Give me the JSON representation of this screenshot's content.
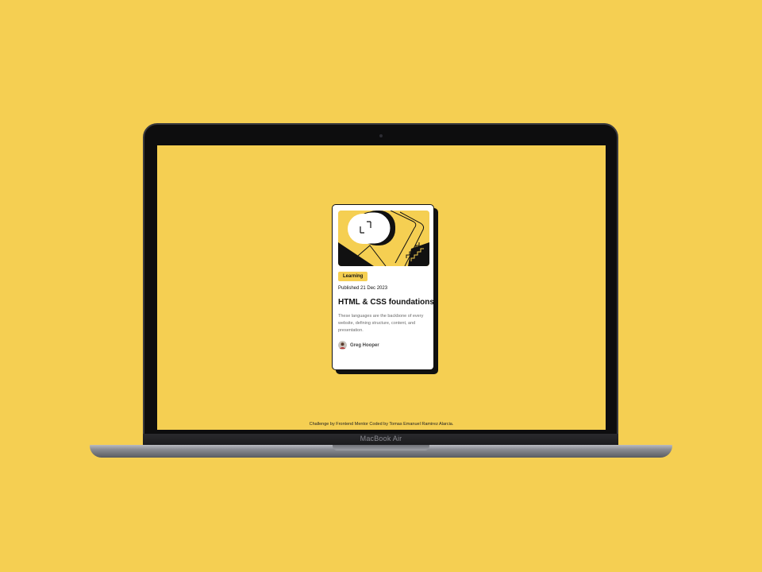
{
  "device": {
    "brand_label": "MacBook Air"
  },
  "card": {
    "tag": "Learning",
    "date": "Published 21 Dec 2023",
    "title": "HTML & CSS foundations",
    "description": "These languages are the backbone of every website, defining structure, content, and presentation.",
    "author": "Greg Hooper"
  },
  "footer": {
    "attribution": "Challenge by Frontend Mentor Coded by Tomas Emanuel Ramirez Alarcia."
  },
  "colors": {
    "background": "#f5cf52",
    "card_background": "#ffffff",
    "text_dark": "#111111",
    "text_muted": "#6b6b6b"
  }
}
